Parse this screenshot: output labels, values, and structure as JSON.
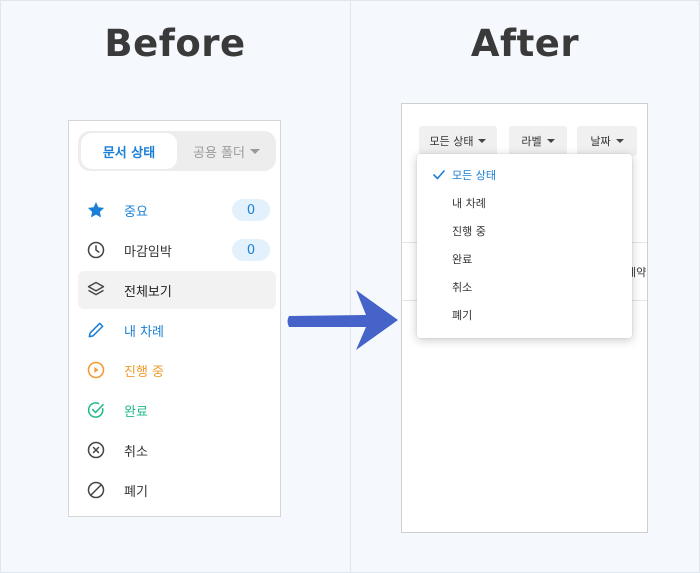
{
  "headings": {
    "before": "Before",
    "after": "After"
  },
  "before": {
    "tabs": {
      "active": "문서 상태",
      "inactive": "공용 폴더"
    },
    "items": [
      {
        "label": "중요",
        "count": "0",
        "color": "#1a7fd6",
        "icon": "star-icon"
      },
      {
        "label": "마감임박",
        "count": "0",
        "color": "#333333",
        "icon": "clock-icon"
      },
      {
        "label": "전체보기",
        "color": "#333333",
        "icon": "layers-icon",
        "selected": true
      },
      {
        "label": "내 차례",
        "color": "#1a7fd6",
        "icon": "pencil-icon"
      },
      {
        "label": "진행 중",
        "color": "#f29a2e",
        "icon": "play-circle-icon"
      },
      {
        "label": "완료",
        "color": "#1eb88a",
        "icon": "check-circle-icon"
      },
      {
        "label": "취소",
        "color": "#333333",
        "icon": "x-circle-icon"
      },
      {
        "label": "폐기",
        "color": "#333333",
        "icon": "ban-icon"
      }
    ]
  },
  "after": {
    "filters": [
      {
        "label": "모든 상태"
      },
      {
        "label": "라벨"
      },
      {
        "label": "날짜"
      }
    ],
    "dropdown": [
      {
        "label": "모든 상태",
        "selected": true
      },
      {
        "label": "내 차례"
      },
      {
        "label": "진행 중"
      },
      {
        "label": "완료"
      },
      {
        "label": "취소"
      },
      {
        "label": "폐기"
      }
    ],
    "background_fragment": "계약"
  },
  "colors": {
    "accent": "#1a7fd6",
    "arrow": "#4563c9"
  }
}
